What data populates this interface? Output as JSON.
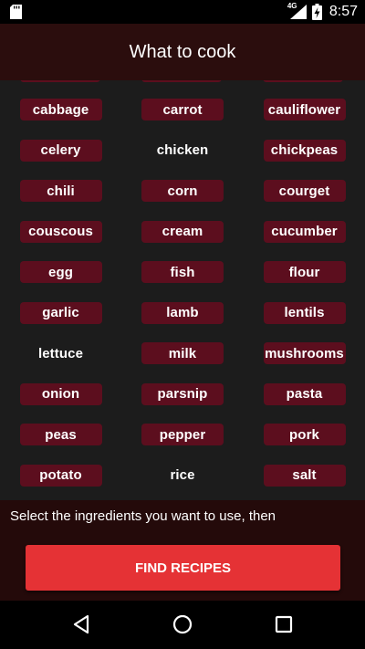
{
  "status_bar": {
    "time": "8:57",
    "network_label": "4G",
    "icons": [
      "sd-card-icon",
      "signal-icon",
      "battery-icon"
    ]
  },
  "app_bar": {
    "title": "What to cook"
  },
  "ingredients": [
    {
      "label": "cabbage",
      "selected": true
    },
    {
      "label": "carrot",
      "selected": true
    },
    {
      "label": "cauliflower",
      "selected": true
    },
    {
      "label": "celery",
      "selected": true
    },
    {
      "label": "chicken",
      "selected": false
    },
    {
      "label": "chickpeas",
      "selected": true
    },
    {
      "label": "chili",
      "selected": true
    },
    {
      "label": "corn",
      "selected": true
    },
    {
      "label": "courget",
      "selected": true
    },
    {
      "label": "couscous",
      "selected": true
    },
    {
      "label": "cream",
      "selected": true
    },
    {
      "label": "cucumber",
      "selected": true
    },
    {
      "label": "egg",
      "selected": true
    },
    {
      "label": "fish",
      "selected": true
    },
    {
      "label": "flour",
      "selected": true
    },
    {
      "label": "garlic",
      "selected": true
    },
    {
      "label": "lamb",
      "selected": true
    },
    {
      "label": "lentils",
      "selected": true
    },
    {
      "label": "lettuce",
      "selected": false
    },
    {
      "label": "milk",
      "selected": true
    },
    {
      "label": "mushrooms",
      "selected": true
    },
    {
      "label": "onion",
      "selected": true
    },
    {
      "label": "parsnip",
      "selected": true
    },
    {
      "label": "pasta",
      "selected": true
    },
    {
      "label": "peas",
      "selected": true
    },
    {
      "label": "pepper",
      "selected": true
    },
    {
      "label": "pork",
      "selected": true
    },
    {
      "label": "potato",
      "selected": true
    },
    {
      "label": "rice",
      "selected": false
    },
    {
      "label": "salt",
      "selected": true
    }
  ],
  "footer": {
    "hint": "Select the ingredients you want to use, then",
    "find_button": "FIND RECIPES"
  },
  "colors": {
    "selected_chip": "#5c0e1e",
    "button": "#e53235",
    "app_bar": "#2b0d0d"
  },
  "nav_bar": {
    "icons": [
      "back-icon",
      "home-icon",
      "recents-icon"
    ]
  }
}
